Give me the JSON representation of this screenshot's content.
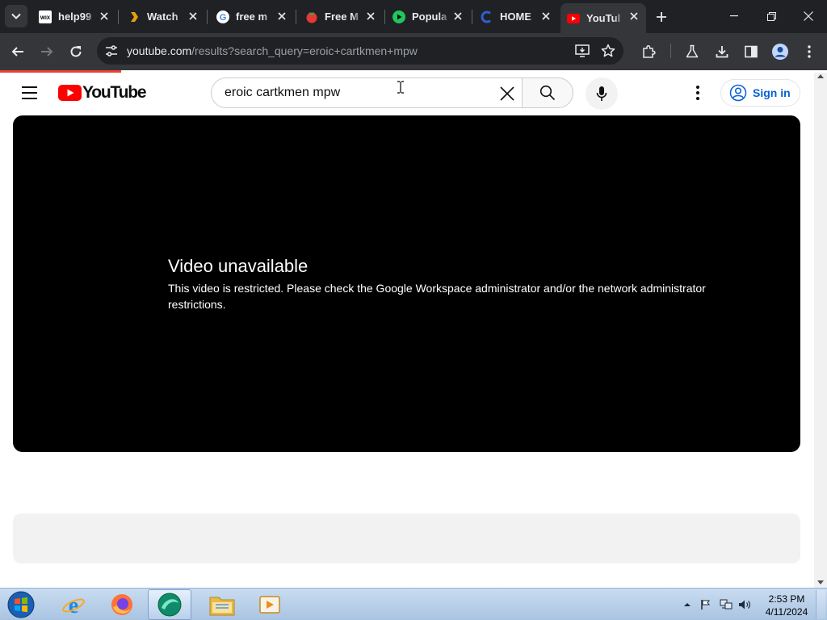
{
  "browser": {
    "tabs": [
      {
        "title": "help99",
        "favicon": "wix-icon",
        "active": false
      },
      {
        "title": "Watch",
        "favicon": "plex-icon",
        "active": false
      },
      {
        "title": "free m",
        "favicon": "google-icon",
        "active": false
      },
      {
        "title": "Free M",
        "favicon": "tomato-icon",
        "active": false
      },
      {
        "title": "Popula",
        "favicon": "play-icon",
        "active": false
      },
      {
        "title": "HOME",
        "favicon": "c-logo-icon",
        "active": false
      },
      {
        "title": "YouTul",
        "favicon": "youtube-icon",
        "active": true
      }
    ],
    "address": {
      "host": "youtube.com",
      "path": "/results?search_query=eroic+cartkmen+mpw"
    }
  },
  "youtube": {
    "logo_text": "YouTube",
    "search": {
      "value": "eroic cartkmen mpw",
      "placeholder": "Search"
    },
    "signin_label": "Sign in",
    "player": {
      "error_title": "Video unavailable",
      "error_message": "This video is restricted. Please check the Google Workspace administrator and/or the network administrator restrictions."
    }
  },
  "taskbar": {
    "time": "2:53 PM",
    "date": "4/11/2024",
    "apps": [
      "internet-explorer-icon",
      "firefox-icon",
      "app-icon",
      "file-explorer-icon",
      "media-player-icon"
    ]
  },
  "colors": {
    "chrome_dark": "#202124",
    "chrome_toolbar": "#35363a",
    "youtube_red": "#ff0000",
    "signin_blue": "#065fd4"
  }
}
